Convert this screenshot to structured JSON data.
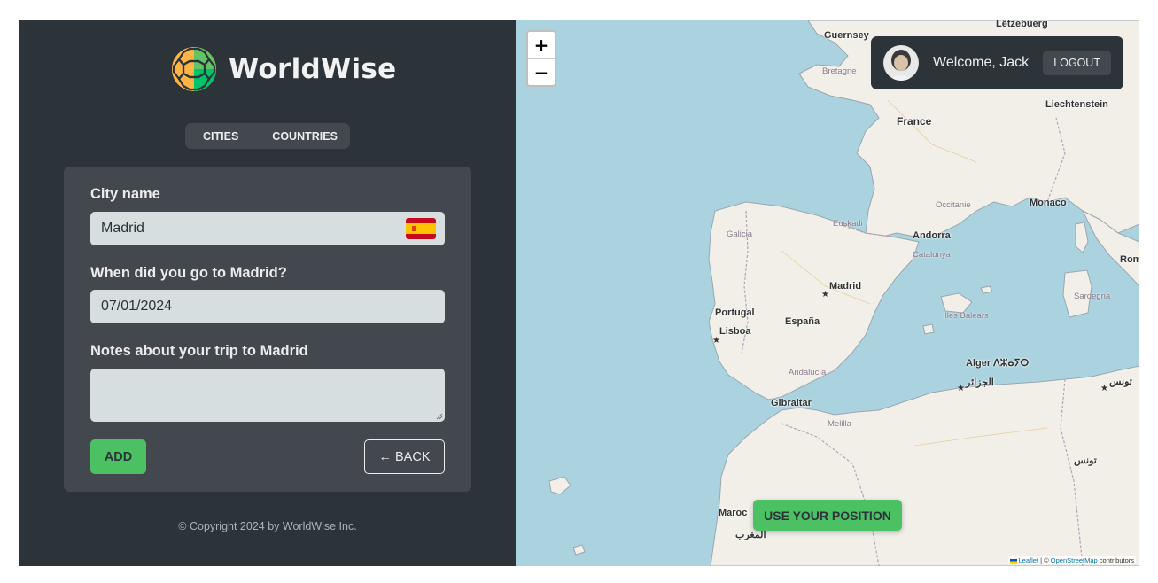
{
  "brand": {
    "name": "WorldWise"
  },
  "nav": {
    "cities": "Cities",
    "countries": "Countries"
  },
  "form": {
    "city_label": "City name",
    "city_value": "Madrid",
    "city_flag": "🇪🇸",
    "date_label": "When did you go to Madrid?",
    "date_value": "07/01/2024",
    "notes_label": "Notes about your trip to Madrid",
    "notes_value": "",
    "add_label": "ADD",
    "back_label": "← BACK"
  },
  "footer": {
    "copyright": "© Copyright 2024 by WorldWise Inc."
  },
  "map": {
    "zoom_in": "+",
    "zoom_out": "−",
    "use_position": "Use your position",
    "attribution": {
      "leaflet": "Leaflet",
      "separator": " | © ",
      "osm": "OpenStreetMap",
      "suffix": " contributors"
    },
    "labels": {
      "letzebuerg": "Lëtzebuerg",
      "guernsey": "Guernsey",
      "bretagne": "Bretagne",
      "france": "France",
      "liechtenstein": "Liechtenstein",
      "monaco": "Monaco",
      "andorra": "Andorra",
      "madrid": "Madrid",
      "portugal": "Portugal",
      "lisboa": "Lisboa",
      "espana": "España",
      "gibraltar": "Gibraltar",
      "alger": "Alger ⴷⵣⴰⵢⵔ",
      "algeria_ar": "الجزائر",
      "tunis_ar": "تونس",
      "tunisia_ar": "تونس",
      "maroc": "Maroc",
      "morocco_ar": "المغرب",
      "galicia": "Galicia",
      "euskadi": "Euskadi",
      "catalunya": "Catalunya",
      "illes_balears": "Illes Balears",
      "andalucia": "Andalucía",
      "occitanie": "Occitanie",
      "melilla": "Melilla",
      "sardegna": "Sardegna",
      "roma": "Rom"
    }
  },
  "user": {
    "welcome": "Welcome, Jack",
    "logout": "Logout"
  },
  "colors": {
    "sidebar": "#2d3439",
    "panel": "#42484d",
    "accent": "#4cc163",
    "input": "#d6dee0",
    "sea": "#aad3df",
    "land": "#f2efe9"
  }
}
